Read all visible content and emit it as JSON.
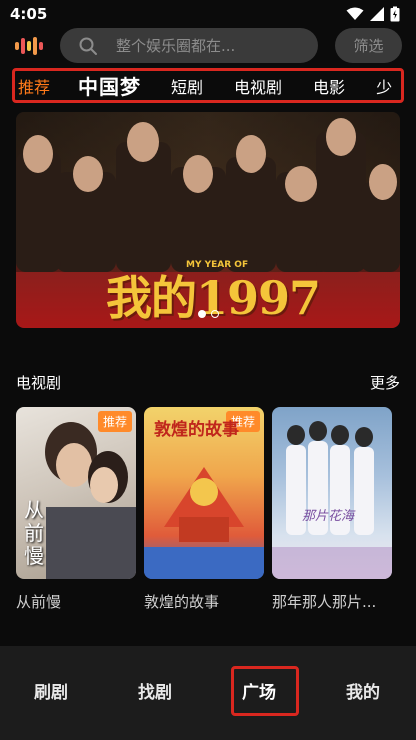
{
  "status": {
    "time": "4:05"
  },
  "search": {
    "placeholder": "整个娱乐圈都在...",
    "filter_label": "筛选"
  },
  "tabs": [
    {
      "label": "推荐",
      "active": true
    },
    {
      "label": "中国梦",
      "active": false
    },
    {
      "label": "短剧",
      "active": false
    },
    {
      "label": "电视剧",
      "active": false
    },
    {
      "label": "电影",
      "active": false
    },
    {
      "label": "少",
      "active": false
    }
  ],
  "banner": {
    "title": "我的1997",
    "subtitle": "MY YEAR OF",
    "slide_count": 2,
    "active_slide": 1
  },
  "section": {
    "title": "电视剧",
    "more": "更多",
    "items": [
      {
        "title": "从前慢",
        "badge": "推荐",
        "poster_text": "从前慢"
      },
      {
        "title": "敦煌的故事",
        "badge": "推荐",
        "poster_text": "敦煌的故事"
      },
      {
        "title": "那年那人那片...",
        "badge": "",
        "poster_text": "那片花海"
      }
    ]
  },
  "bottom_nav": [
    {
      "label": "刷剧",
      "active": false
    },
    {
      "label": "找剧",
      "active": false
    },
    {
      "label": "广场",
      "active": true
    },
    {
      "label": "我的",
      "active": false
    }
  ],
  "colors": {
    "accent": "#ff7a1a",
    "highlight": "#d9271f",
    "badge": "#ff8a2a"
  }
}
